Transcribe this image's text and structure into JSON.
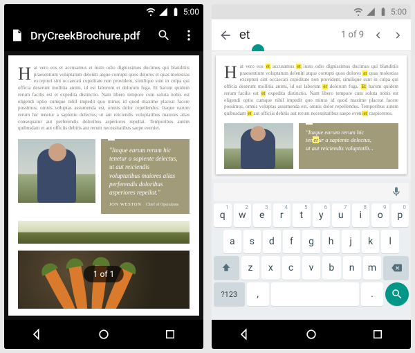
{
  "status": {
    "time": "5:00"
  },
  "left": {
    "title": "DryCreekBrochure.pdf",
    "page_badge": "1 of 1",
    "paragraph": "at vero eos et accusamus et iusto odio dignissimos ducimus qui blanditiis praesentium voluptatum deleniti atque corrupti quos dolores et quas molestias excepturi sint occaecati cupiditate non provident, similique sunt in culpa qui officia deserunt mollitia animi, id est laborum et dolorum fuga. Et harum quidem rerum facilis est et expedita distinctio. Nam libero tempore cum soluta nobis est eligendi optio cumque nihil impedit quo minus id quod maxime placeat facere possimus, omnis voluptas assumenda est, omnis dolor repellendus. Itaque earum rerum hic tenetur a sapiente delectus, ut aut reiciendis voluptatibus maiores alias consequatur aut perferendis doloribus asperiores repellat. Temporibus autem quibusdam et aut officiis debitis aut rerum necessitatibus saepe eveniet.",
    "dropcap": "H",
    "quote": {
      "text": "\"Itaque earum rerum hic tenetur a sapiente delectus, ut aut reiciendis voluptatibus maiores alias perferendis doloribus asperiores repellat.\"",
      "name": "JON WESTON",
      "role": "Chief of Operations"
    }
  },
  "right": {
    "query": "et",
    "counter": "1 of 9",
    "dropcap": "H",
    "para_segs": [
      {
        "t": "at vero eos ",
        "h": false
      },
      {
        "t": "et",
        "h": true
      },
      {
        "t": " accusamus ",
        "h": false
      },
      {
        "t": "et",
        "h": true
      },
      {
        "t": " iusto odio dignissimos ducimus qui blanditiis praesentium voluptatum deleniti atque corrupti quos dolores ",
        "h": false
      },
      {
        "t": "et",
        "h": true
      },
      {
        "t": " quas molestias excepturi sint occaecati cupiditate non provident, similique sunt in culpa qui officia deserunt mollitia animi, id est laborum ",
        "h": false
      },
      {
        "t": "et",
        "h": true
      },
      {
        "t": " dolorum fuga. ",
        "h": false
      },
      {
        "t": "Et",
        "h": true
      },
      {
        "t": " harum quidem rerum facilis est ",
        "h": false
      },
      {
        "t": "et",
        "h": true
      },
      {
        "t": " expedita distinctio. Nam libero tempore cum soluta nobis est eligendi optio cumque nihil impedit quo minus id quod maxime placeat facere possimus, omnis voluptas assumenda est, omnis dolor repellendus. Temporibus autem quibusdam ",
        "h": false
      },
      {
        "t": "et",
        "h": true
      },
      {
        "t": " aut officiis debitis aut rerum necessitatibus saepe eveni",
        "h": false
      },
      {
        "t": "et",
        "h": true
      },
      {
        "t": " caspioreres.",
        "h": false
      }
    ],
    "quote": {
      "line1": "\"Itaque earum rerum hic",
      "line2_a": "ten",
      "line2_b": "et",
      "line2_c": "ur a sapiente delectus,",
      "line3": "ut aut reiciendis voluptatib..."
    }
  },
  "keyboard": {
    "row1": [
      {
        "k": "q",
        "n": "1"
      },
      {
        "k": "w",
        "n": "2"
      },
      {
        "k": "e",
        "n": "3"
      },
      {
        "k": "r",
        "n": "4"
      },
      {
        "k": "t",
        "n": "5"
      },
      {
        "k": "y",
        "n": "6"
      },
      {
        "k": "u",
        "n": "7"
      },
      {
        "k": "i",
        "n": "8"
      },
      {
        "k": "o",
        "n": "9"
      },
      {
        "k": "p",
        "n": "0"
      }
    ],
    "row2": [
      "a",
      "s",
      "d",
      "f",
      "g",
      "h",
      "j",
      "k",
      "l"
    ],
    "row3": [
      "z",
      "x",
      "c",
      "v",
      "b",
      "n",
      "m"
    ],
    "symkey": "?123",
    "comma": ",",
    "period": "."
  }
}
